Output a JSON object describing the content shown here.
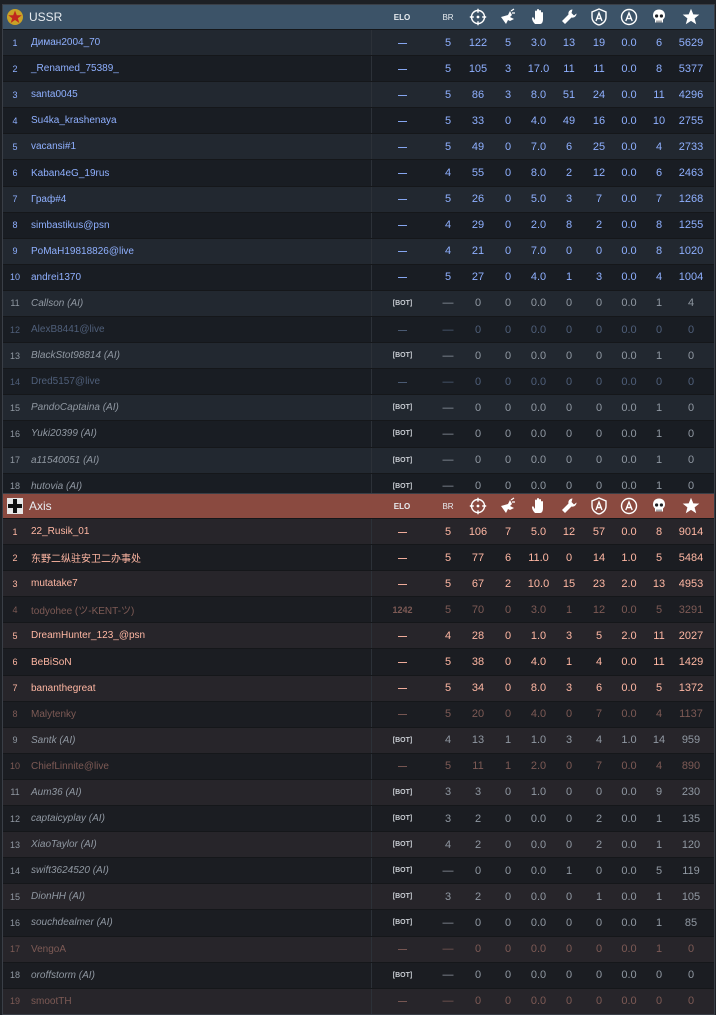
{
  "elo_label": "ELO",
  "br_label": "BR",
  "icons": [
    "crosshair-icon",
    "bomber-icon",
    "hand-icon",
    "wrench-icon",
    "shield-a-icon",
    "circle-a-icon",
    "skull-icon",
    "star-icon"
  ],
  "teams": [
    {
      "name": "USSR",
      "rows": [
        {
          "n": "1",
          "name": "Диман2004_70",
          "elo": "—",
          "br": "5",
          "s": [
            "122",
            "5",
            "3.0",
            "13",
            "19",
            "0.0",
            "6",
            "5629"
          ],
          "kind": "active"
        },
        {
          "n": "2",
          "name": "_Renamed_75389_",
          "elo": "—",
          "br": "5",
          "s": [
            "105",
            "3",
            "17.0",
            "11",
            "11",
            "0.0",
            "8",
            "5377"
          ],
          "kind": "active"
        },
        {
          "n": "3",
          "name": "santa0045",
          "elo": "—",
          "br": "5",
          "s": [
            "86",
            "3",
            "8.0",
            "51",
            "24",
            "0.0",
            "11",
            "4296"
          ],
          "kind": "active"
        },
        {
          "n": "4",
          "name": "Su4ka_krashenaya",
          "elo": "—",
          "br": "5",
          "s": [
            "33",
            "0",
            "4.0",
            "49",
            "16",
            "0.0",
            "10",
            "2755"
          ],
          "kind": "active"
        },
        {
          "n": "5",
          "name": "vacansi#1",
          "elo": "—",
          "br": "5",
          "s": [
            "49",
            "0",
            "7.0",
            "6",
            "25",
            "0.0",
            "4",
            "2733"
          ],
          "kind": "active"
        },
        {
          "n": "6",
          "name": "Kaban4eG_19rus",
          "elo": "—",
          "br": "4",
          "s": [
            "55",
            "0",
            "8.0",
            "2",
            "12",
            "0.0",
            "6",
            "2463"
          ],
          "kind": "active"
        },
        {
          "n": "7",
          "name": "Граф#4",
          "elo": "—",
          "br": "5",
          "s": [
            "26",
            "0",
            "5.0",
            "3",
            "7",
            "0.0",
            "7",
            "1268"
          ],
          "kind": "active"
        },
        {
          "n": "8",
          "name": "simbastikus@psn",
          "elo": "—",
          "br": "4",
          "s": [
            "29",
            "0",
            "2.0",
            "8",
            "2",
            "0.0",
            "8",
            "1255"
          ],
          "kind": "active"
        },
        {
          "n": "9",
          "name": "PoMaH19818826@live",
          "elo": "—",
          "br": "4",
          "s": [
            "21",
            "0",
            "7.0",
            "0",
            "0",
            "0.0",
            "8",
            "1020"
          ],
          "kind": "active"
        },
        {
          "n": "10",
          "name": "andrei1370",
          "elo": "—",
          "br": "5",
          "s": [
            "27",
            "0",
            "4.0",
            "1",
            "3",
            "0.0",
            "4",
            "1004"
          ],
          "kind": "active"
        },
        {
          "n": "11",
          "name": "Callson (AI)",
          "elo": "[BOT]",
          "br": "—",
          "s": [
            "0",
            "0",
            "0.0",
            "0",
            "0",
            "0.0",
            "1",
            "4"
          ],
          "kind": "bot"
        },
        {
          "n": "12",
          "name": "AlexB8441@live",
          "elo": "—",
          "br": "—",
          "s": [
            "0",
            "0",
            "0.0",
            "0",
            "0",
            "0.0",
            "0",
            "0"
          ],
          "kind": "left"
        },
        {
          "n": "13",
          "name": "BlackStot98814 (AI)",
          "elo": "[BOT]",
          "br": "—",
          "s": [
            "0",
            "0",
            "0.0",
            "0",
            "0",
            "0.0",
            "1",
            "0"
          ],
          "kind": "bot"
        },
        {
          "n": "14",
          "name": "Dred5157@live",
          "elo": "—",
          "br": "—",
          "s": [
            "0",
            "0",
            "0.0",
            "0",
            "0",
            "0.0",
            "0",
            "0"
          ],
          "kind": "left"
        },
        {
          "n": "15",
          "name": "PandoCaptaina (AI)",
          "elo": "[BOT]",
          "br": "—",
          "s": [
            "0",
            "0",
            "0.0",
            "0",
            "0",
            "0.0",
            "1",
            "0"
          ],
          "kind": "bot"
        },
        {
          "n": "16",
          "name": "Yuki20399 (AI)",
          "elo": "[BOT]",
          "br": "—",
          "s": [
            "0",
            "0",
            "0.0",
            "0",
            "0",
            "0.0",
            "1",
            "0"
          ],
          "kind": "bot"
        },
        {
          "n": "17",
          "name": "a11540051 (AI)",
          "elo": "[BOT]",
          "br": "—",
          "s": [
            "0",
            "0",
            "0.0",
            "0",
            "0",
            "0.0",
            "1",
            "0"
          ],
          "kind": "bot"
        },
        {
          "n": "18",
          "name": "hutovia (AI)",
          "elo": "[BOT]",
          "br": "—",
          "s": [
            "0",
            "0",
            "0.0",
            "0",
            "0",
            "0.0",
            "1",
            "0"
          ],
          "kind": "bot"
        }
      ]
    },
    {
      "name": "Axis",
      "rows": [
        {
          "n": "1",
          "name": "22_Rusik_01",
          "elo": "—",
          "br": "5",
          "s": [
            "106",
            "7",
            "5.0",
            "12",
            "57",
            "0.0",
            "8",
            "9014"
          ],
          "kind": "active"
        },
        {
          "n": "2",
          "name": "东野二纵驻安卫二办事处",
          "elo": "—",
          "br": "5",
          "s": [
            "77",
            "6",
            "11.0",
            "0",
            "14",
            "1.0",
            "5",
            "5484"
          ],
          "kind": "active"
        },
        {
          "n": "3",
          "name": "mutatake7",
          "elo": "—",
          "br": "5",
          "s": [
            "67",
            "2",
            "10.0",
            "15",
            "23",
            "2.0",
            "13",
            "4953"
          ],
          "kind": "active"
        },
        {
          "n": "4",
          "name": "todyohee (ツ-KENT-ツ)",
          "elo": "1242",
          "br": "5",
          "s": [
            "70",
            "0",
            "3.0",
            "1",
            "12",
            "0.0",
            "5",
            "3291"
          ],
          "kind": "left"
        },
        {
          "n": "5",
          "name": "DreamHunter_123_@psn",
          "elo": "—",
          "br": "4",
          "s": [
            "28",
            "0",
            "1.0",
            "3",
            "5",
            "2.0",
            "11",
            "2027"
          ],
          "kind": "active"
        },
        {
          "n": "6",
          "name": "BeBiSoN",
          "elo": "—",
          "br": "5",
          "s": [
            "38",
            "0",
            "4.0",
            "1",
            "4",
            "0.0",
            "11",
            "1429"
          ],
          "kind": "active"
        },
        {
          "n": "7",
          "name": "bananthegreat",
          "elo": "—",
          "br": "5",
          "s": [
            "34",
            "0",
            "8.0",
            "3",
            "6",
            "0.0",
            "5",
            "1372"
          ],
          "kind": "active"
        },
        {
          "n": "8",
          "name": "Malytenky",
          "elo": "—",
          "br": "5",
          "s": [
            "20",
            "0",
            "4.0",
            "0",
            "7",
            "0.0",
            "4",
            "1137"
          ],
          "kind": "left"
        },
        {
          "n": "9",
          "name": "Santk (AI)",
          "elo": "[BOT]",
          "br": "4",
          "s": [
            "13",
            "1",
            "1.0",
            "3",
            "4",
            "1.0",
            "14",
            "959"
          ],
          "kind": "bot"
        },
        {
          "n": "10",
          "name": "ChiefLinnite@live",
          "elo": "—",
          "br": "5",
          "s": [
            "11",
            "1",
            "2.0",
            "0",
            "7",
            "0.0",
            "4",
            "890"
          ],
          "kind": "left"
        },
        {
          "n": "11",
          "name": "Aum36 (AI)",
          "elo": "[BOT]",
          "br": "3",
          "s": [
            "3",
            "0",
            "1.0",
            "0",
            "0",
            "0.0",
            "9",
            "230"
          ],
          "kind": "bot"
        },
        {
          "n": "12",
          "name": "captaicyplay (AI)",
          "elo": "[BOT]",
          "br": "3",
          "s": [
            "2",
            "0",
            "0.0",
            "0",
            "2",
            "0.0",
            "1",
            "135"
          ],
          "kind": "bot"
        },
        {
          "n": "13",
          "name": "XiaoTaylor (AI)",
          "elo": "[BOT]",
          "br": "4",
          "s": [
            "2",
            "0",
            "0.0",
            "0",
            "2",
            "0.0",
            "1",
            "120"
          ],
          "kind": "bot"
        },
        {
          "n": "14",
          "name": "swift3624520 (AI)",
          "elo": "[BOT]",
          "br": "—",
          "s": [
            "0",
            "0",
            "0.0",
            "1",
            "0",
            "0.0",
            "5",
            "119"
          ],
          "kind": "bot"
        },
        {
          "n": "15",
          "name": "DionHH (AI)",
          "elo": "[BOT]",
          "br": "3",
          "s": [
            "2",
            "0",
            "0.0",
            "0",
            "1",
            "0.0",
            "1",
            "105"
          ],
          "kind": "bot"
        },
        {
          "n": "16",
          "name": "souchdealmer (AI)",
          "elo": "[BOT]",
          "br": "—",
          "s": [
            "0",
            "0",
            "0.0",
            "0",
            "0",
            "0.0",
            "1",
            "85"
          ],
          "kind": "bot"
        },
        {
          "n": "17",
          "name": "VengoA",
          "elo": "—",
          "br": "—",
          "s": [
            "0",
            "0",
            "0.0",
            "0",
            "0",
            "0.0",
            "1",
            "0"
          ],
          "kind": "left"
        },
        {
          "n": "18",
          "name": "oroffstorm (AI)",
          "elo": "[BOT]",
          "br": "—",
          "s": [
            "0",
            "0",
            "0.0",
            "0",
            "0",
            "0.0",
            "0",
            "0"
          ],
          "kind": "bot"
        },
        {
          "n": "19",
          "name": "smootTH",
          "elo": "—",
          "br": "—",
          "s": [
            "0",
            "0",
            "0.0",
            "0",
            "0",
            "0.0",
            "0",
            "0"
          ],
          "kind": "left"
        }
      ]
    }
  ]
}
